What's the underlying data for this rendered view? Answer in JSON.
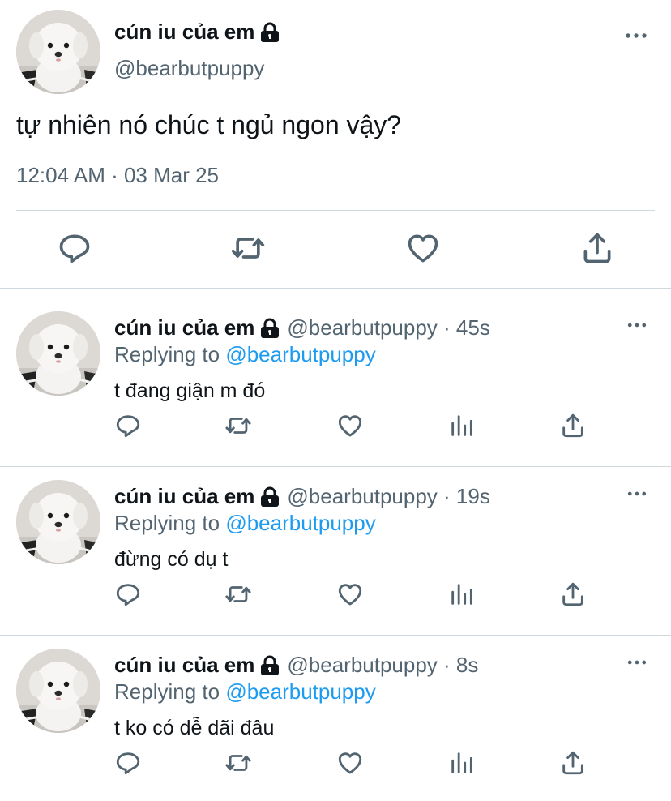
{
  "main_tweet": {
    "author_name": "cún iu của em",
    "author_handle": "@bearbutpuppy",
    "text": "tự nhiên nó chúc t ngủ ngon vậy?",
    "timestamp": "12:04 AM · 03 Mar 25",
    "icons": [
      "reply-icon",
      "retweet-icon",
      "like-icon",
      "share-icon"
    ]
  },
  "replies": [
    {
      "author_name": "cún iu của em",
      "handle_time": "@bearbutpuppy · 45s",
      "replying_prefix": "Replying to",
      "replying_to": "@bearbutpuppy",
      "text": "t đang giận m đó"
    },
    {
      "author_name": "cún iu của em",
      "handle_time": "@bearbutpuppy · 19s",
      "replying_prefix": "Replying to",
      "replying_to": "@bearbutpuppy",
      "text": "đừng có dụ t"
    },
    {
      "author_name": "cún iu của em",
      "handle_time": "@bearbutpuppy · 8s",
      "replying_prefix": "Replying to",
      "replying_to": "@bearbutpuppy",
      "text": "t ko có dễ dãi đâu"
    }
  ],
  "colors": {
    "text_primary": "#0f1419",
    "text_secondary": "#536471",
    "link": "#1d9bf0",
    "divider": "#cfd9de"
  }
}
